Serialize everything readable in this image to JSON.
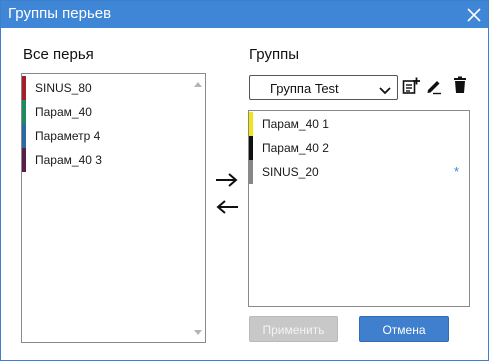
{
  "window": {
    "title": "Группы перьев",
    "title_bar_color": "#3f86d6",
    "close_icon": "close-icon"
  },
  "all_pens": {
    "heading": "Все перья",
    "items": [
      {
        "label": "SINUS_80",
        "color": "#a3202a"
      },
      {
        "label": "Парам_40",
        "color": "#1e8b5e"
      },
      {
        "label": "Параметр 4",
        "color": "#2b6aa3"
      },
      {
        "label": "Парам_40 3",
        "color": "#5a1e4a"
      }
    ]
  },
  "transfer": {
    "add_icon": "arrow-right-icon",
    "remove_icon": "arrow-left-icon"
  },
  "groups": {
    "heading": "Группы",
    "selected_group": "Группа Test",
    "toolbar": {
      "add_icon": "playlist-add-icon",
      "rename_icon": "edit-icon",
      "delete_icon": "trash-icon"
    },
    "items": [
      {
        "label": "Парам_40 1",
        "color": "#f2e41b",
        "marker": ""
      },
      {
        "label": "Парам_40 2",
        "color": "#111111",
        "marker": ""
      },
      {
        "label": "SINUS_20",
        "color": "#888888",
        "marker": "*"
      }
    ]
  },
  "buttons": {
    "apply": "Применить",
    "cancel": "Отмена",
    "accent_color": "#3f7fce"
  }
}
